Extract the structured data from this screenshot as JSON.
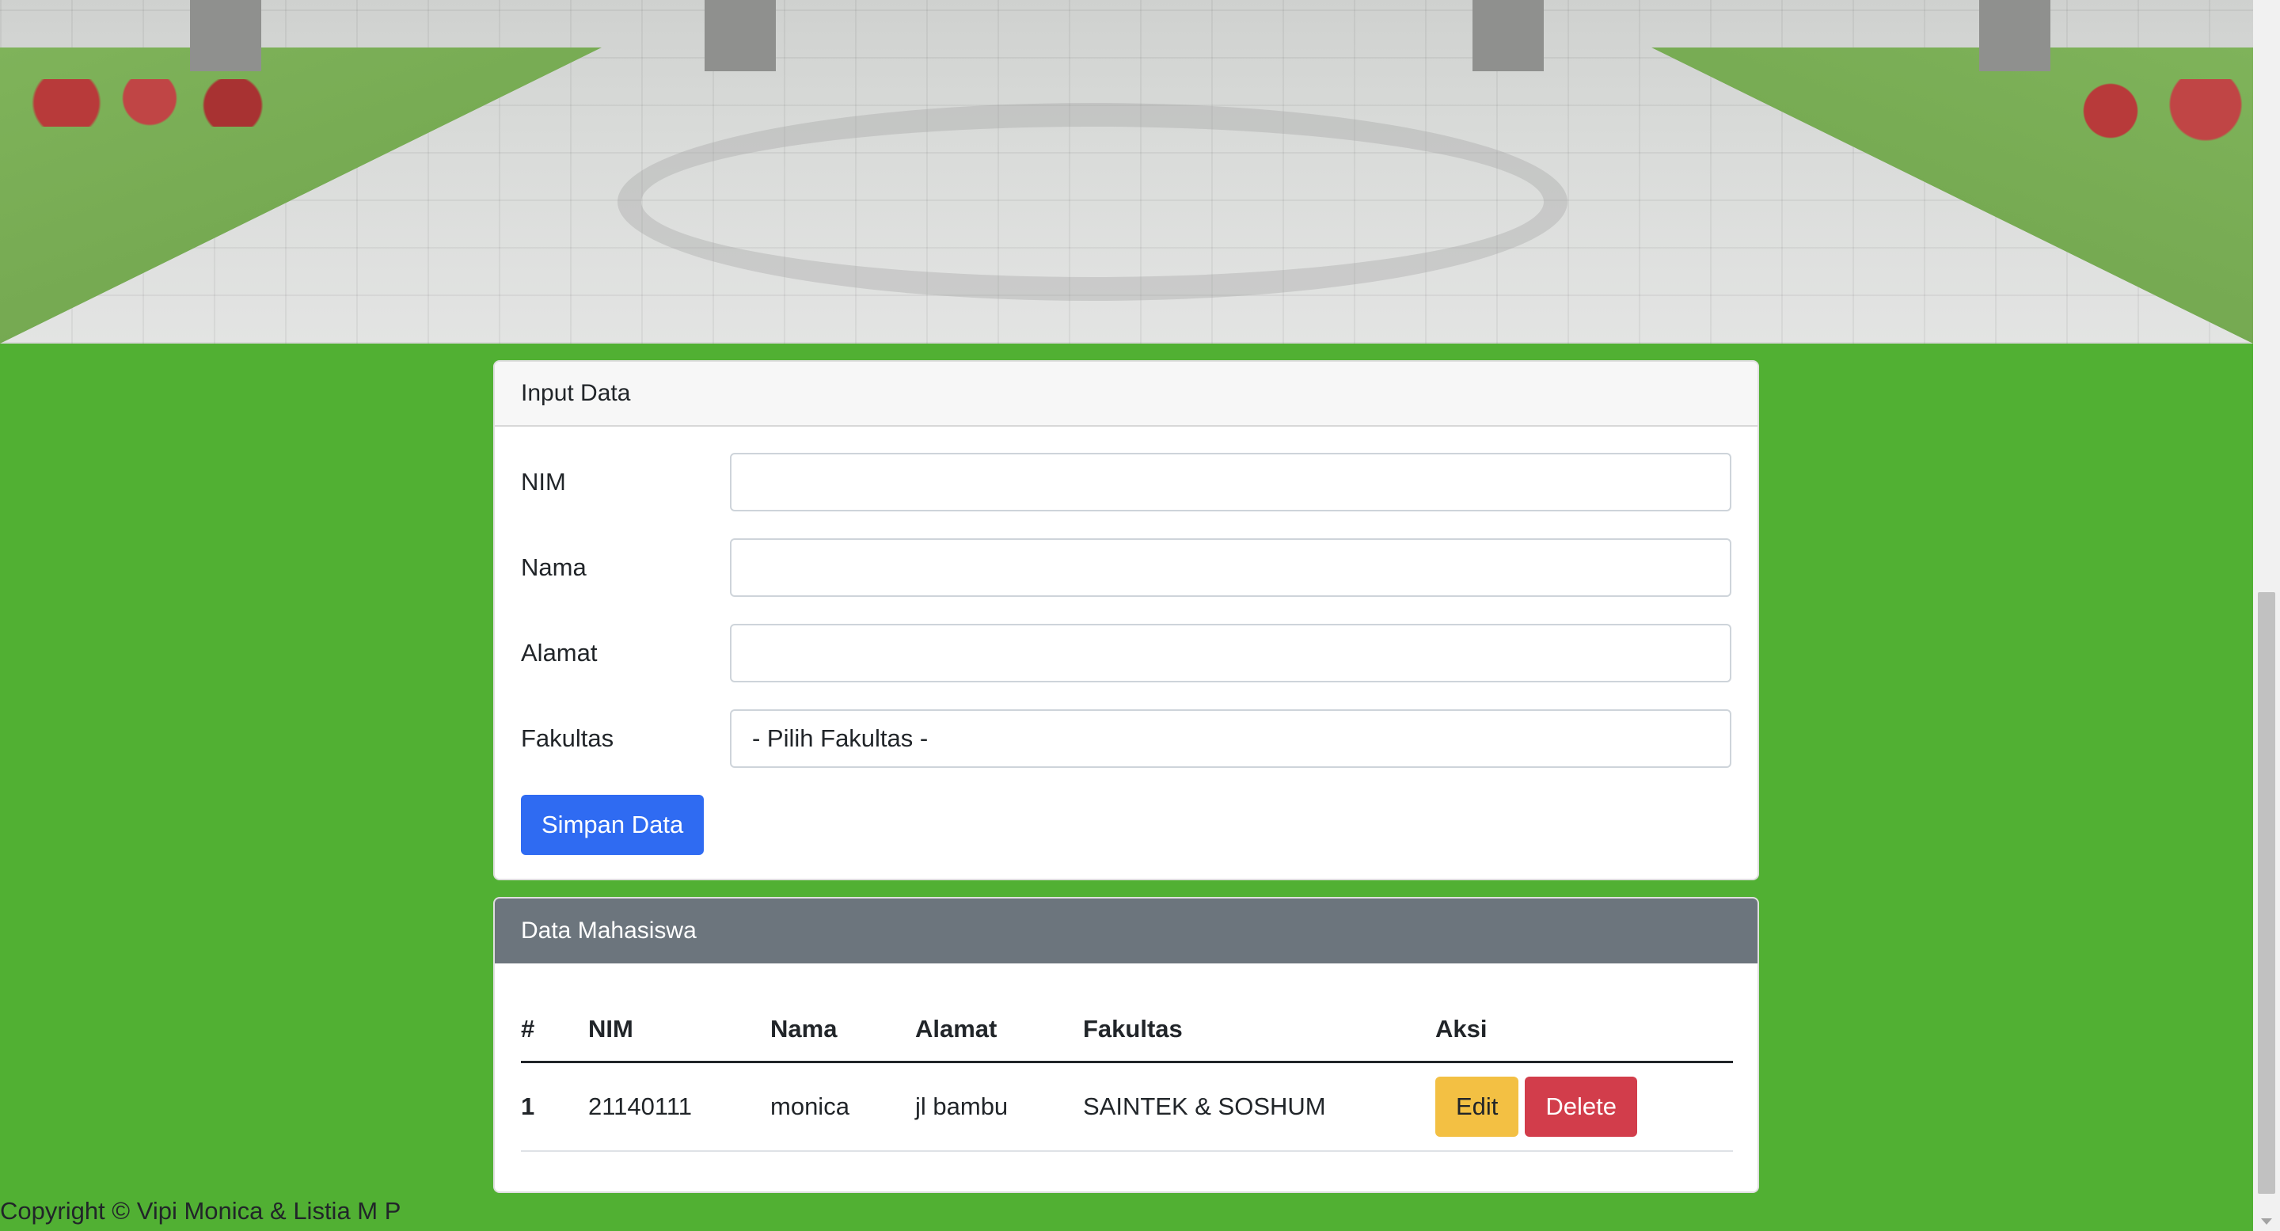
{
  "input_card": {
    "title": "Input Data",
    "fields": [
      {
        "label": "NIM",
        "value": ""
      },
      {
        "label": "Nama",
        "value": ""
      },
      {
        "label": "Alamat",
        "value": ""
      },
      {
        "label": "Fakultas",
        "value": "- Pilih Fakultas -"
      }
    ],
    "submit_label": "Simpan Data"
  },
  "table_card": {
    "title": "Data Mahasiswa",
    "columns": [
      "#",
      "NIM",
      "Nama",
      "Alamat",
      "Fakultas",
      "Aksi"
    ],
    "rows": [
      {
        "no": "1",
        "nim": "21140111",
        "nama": "monica",
        "alamat": "jl bambu",
        "fakultas": "SAINTEK & SOSHUM",
        "edit_label": "Edit",
        "delete_label": "Delete"
      }
    ]
  },
  "footer": {
    "text": "Copyright © Vipi Monica & Listia M P"
  },
  "colors": {
    "background": "#51b033",
    "primary": "#2f6bf2",
    "warning": "#f3c043",
    "danger": "#d23d4b",
    "header_gray": "#6c757d"
  }
}
